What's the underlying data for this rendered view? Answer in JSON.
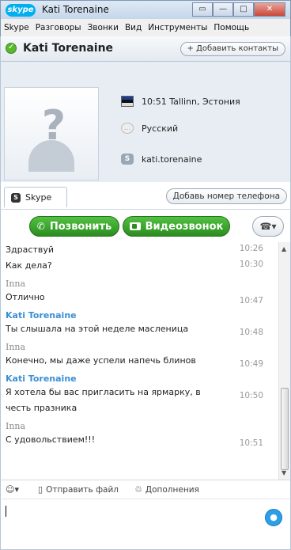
{
  "window": {
    "app_logo": "skype",
    "title": "Kati Torenaine",
    "controls": [
      "restore",
      "minimize",
      "maximize",
      "close"
    ]
  },
  "menu": [
    "Skype",
    "Разговоры",
    "Звонки",
    "Вид",
    "Инструменты",
    "Помощь"
  ],
  "contact": {
    "name": "Kati Torenaine",
    "status": "online",
    "add_contact_label": "+ Добавить контакты"
  },
  "profile": {
    "local_time": "10:51 Tallinn, Эстония",
    "language": "Русский",
    "skype_name": "kati.torenaine"
  },
  "tabs": {
    "skype_tab": "Skype",
    "add_phone_label": "Добавь номер телефона"
  },
  "actions": {
    "call_label": "Позвонить",
    "video_label": "Видеозвонок",
    "dialpad_icon": "dialpad-icon"
  },
  "messages": [
    {
      "sender": "",
      "role": "",
      "text": "Здраствуй",
      "time": "10:26"
    },
    {
      "sender": "",
      "role": "",
      "text": "Как дела?",
      "time": "10:30"
    },
    {
      "sender": "Inna",
      "role": "me",
      "text": "Отлично",
      "time": "10:47"
    },
    {
      "sender": "Kati Torenaine",
      "role": "other",
      "text": "Ты слышала на этой неделе масленица",
      "time": "10:48"
    },
    {
      "sender": "Inna",
      "role": "me",
      "text": "Конечно, мы даже успели напечь блинов",
      "time": "10:49"
    },
    {
      "sender": "Kati Torenaine",
      "role": "other",
      "text": "Я хотела бы вас пригласить на ярмарку, в честь празника",
      "time": "10:50"
    },
    {
      "sender": "Inna",
      "role": "me",
      "text": "С удовольствием!!!",
      "time": "10:51"
    }
  ],
  "composer": {
    "emoticon_icon": "smiley-icon",
    "send_file_label": "Отправить файл",
    "addons_label": "Дополнения",
    "input_value": ""
  },
  "colors": {
    "accent_green": "#2b8d1f",
    "contact_name_blue": "#3b8fd4",
    "skype_blue": "#00aff0"
  }
}
